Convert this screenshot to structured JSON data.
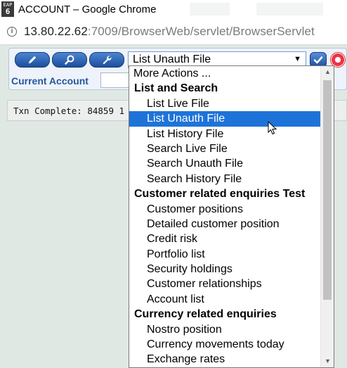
{
  "window": {
    "title": "ACCOUNT – Google Chrome",
    "app_icon_top": "EAP",
    "app_icon_bottom": "6"
  },
  "addressbar": {
    "url_host": "13.80.22.62",
    "url_rest": ":7009/BrowserWeb/servlet/BrowserServlet",
    "security_icon": "info-icon"
  },
  "toolbar": {
    "buttons": [
      {
        "name": "edit-button",
        "icon": "pencil-icon"
      },
      {
        "name": "view-button",
        "icon": "magnifier-icon"
      },
      {
        "name": "tools-button",
        "icon": "wrench-icon"
      }
    ],
    "select_value": "List Unauth File",
    "go_icon": "checkmark-icon",
    "help_icon": "lifebuoy-icon",
    "current_account_label": "Current Account",
    "current_account_value": ""
  },
  "status": {
    "txn_text": "Txn Complete: 84859 1"
  },
  "dropdown": {
    "selected_index": 3,
    "items": [
      {
        "label": "More Actions ...",
        "kind": "first"
      },
      {
        "label": "List and Search",
        "kind": "group"
      },
      {
        "label": "List Live File",
        "kind": "opt"
      },
      {
        "label": "List Unauth File",
        "kind": "opt"
      },
      {
        "label": "List History File",
        "kind": "opt"
      },
      {
        "label": "Search Live File",
        "kind": "opt"
      },
      {
        "label": "Search Unauth File",
        "kind": "opt"
      },
      {
        "label": "Search History File",
        "kind": "opt"
      },
      {
        "label": "Customer related enquiries Test",
        "kind": "group"
      },
      {
        "label": "Customer positions",
        "kind": "opt"
      },
      {
        "label": "Detailed customer position",
        "kind": "opt"
      },
      {
        "label": "Credit risk",
        "kind": "opt"
      },
      {
        "label": "Portfolio list",
        "kind": "opt"
      },
      {
        "label": "Security holdings",
        "kind": "opt"
      },
      {
        "label": "Customer relationships",
        "kind": "opt"
      },
      {
        "label": "Account list",
        "kind": "opt"
      },
      {
        "label": "Currency related enquiries",
        "kind": "group"
      },
      {
        "label": "Nostro position",
        "kind": "opt"
      },
      {
        "label": "Currency movements today",
        "kind": "opt"
      },
      {
        "label": "Exchange rates",
        "kind": "opt"
      }
    ]
  },
  "colors": {
    "accent": "#1e73d9",
    "page_bg": "#dfe8e2",
    "label_blue": "#27579b"
  }
}
